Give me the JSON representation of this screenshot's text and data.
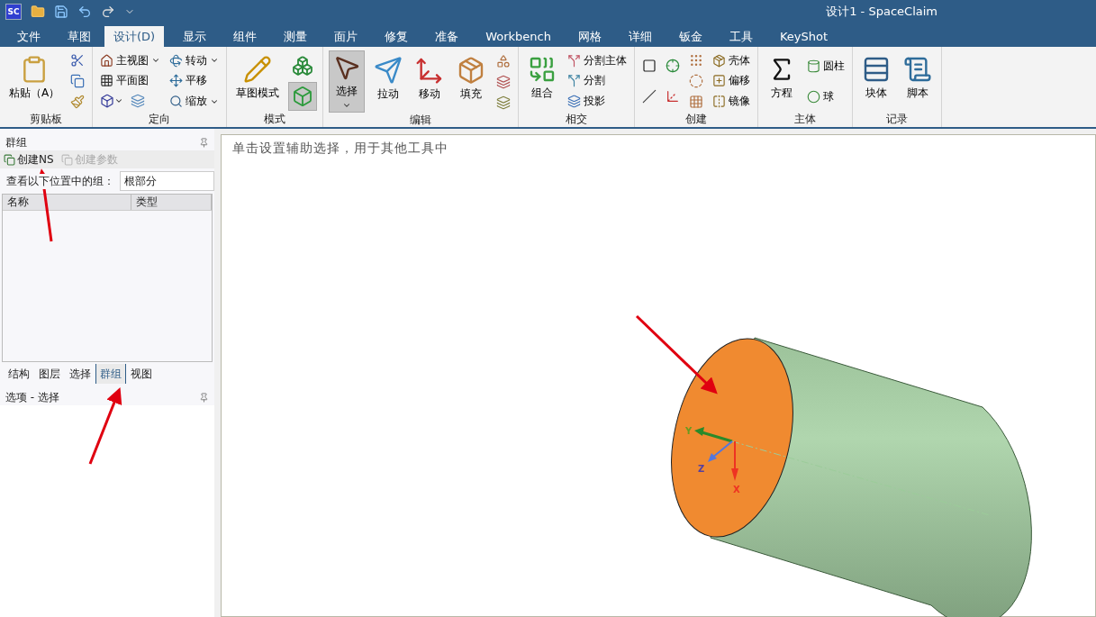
{
  "titlebar": {
    "logo": "SC",
    "title": "设计1 - SpaceClaim"
  },
  "tabs": [
    {
      "label": "文件",
      "selected": false
    },
    {
      "label": "草图",
      "selected": false
    },
    {
      "label": "设计(D)",
      "selected": true
    },
    {
      "label": "显示",
      "selected": false
    },
    {
      "label": "组件",
      "selected": false
    },
    {
      "label": "测量",
      "selected": false
    },
    {
      "label": "面片",
      "selected": false
    },
    {
      "label": "修复",
      "selected": false
    },
    {
      "label": "准备",
      "selected": false
    },
    {
      "label": "Workbench",
      "selected": false
    },
    {
      "label": "网格",
      "selected": false
    },
    {
      "label": "详细",
      "selected": false
    },
    {
      "label": "钣金",
      "selected": false
    },
    {
      "label": "工具",
      "selected": false
    },
    {
      "label": "KeyShot",
      "selected": false
    }
  ],
  "ribbon": [
    {
      "label": "剪贴板",
      "columns": [
        [
          [
            {
              "kind": "large",
              "label": "粘贴（A）",
              "active": false,
              "dropdown": false
            }
          ]
        ],
        [
          [
            {
              "kind": "icon",
              "active": false,
              "dropdown": false
            }
          ],
          [
            {
              "kind": "icon",
              "active": false,
              "dropdown": false
            }
          ],
          [
            {
              "kind": "icon",
              "active": false,
              "dropdown": false
            }
          ]
        ]
      ]
    },
    {
      "label": "定向",
      "columns": [
        [
          [
            {
              "kind": "small",
              "label": "主视图",
              "active": false,
              "dropdown": true
            }
          ],
          [
            {
              "kind": "small",
              "label": "平面图",
              "active": false,
              "dropdown": false
            }
          ],
          [
            {
              "kind": "icon",
              "active": false,
              "dropdown": true
            },
            {
              "kind": "icon",
              "active": false,
              "dropdown": false
            }
          ]
        ],
        [
          [
            {
              "kind": "small",
              "label": "转动",
              "active": false,
              "dropdown": true
            }
          ],
          [
            {
              "kind": "small",
              "label": "平移",
              "active": false,
              "dropdown": false
            }
          ],
          [
            {
              "kind": "small",
              "label": "缩放",
              "active": false,
              "dropdown": true
            }
          ]
        ]
      ]
    },
    {
      "label": "模式",
      "columns": [
        [
          [
            {
              "kind": "large",
              "label": "草图模式",
              "active": false,
              "dropdown": false
            }
          ]
        ],
        [
          [
            {
              "kind": "bigicon",
              "active": false,
              "dropdown": false
            }
          ],
          [
            {
              "kind": "bigicon",
              "active": true,
              "dropdown": false
            }
          ]
        ]
      ]
    },
    {
      "label": "编辑",
      "columns": [
        [
          [
            {
              "kind": "large",
              "label": "选择",
              "active": true,
              "dropdown": true
            }
          ]
        ],
        [
          [
            {
              "kind": "large",
              "label": "拉动",
              "active": false,
              "dropdown": false
            }
          ]
        ],
        [
          [
            {
              "kind": "large",
              "label": "移动",
              "active": false,
              "dropdown": false
            }
          ]
        ],
        [
          [
            {
              "kind": "large",
              "label": "填充",
              "active": false,
              "dropdown": false
            }
          ]
        ],
        [
          [
            {
              "kind": "icon",
              "active": false,
              "dropdown": false
            }
          ],
          [
            {
              "kind": "icon",
              "active": false,
              "dropdown": false
            }
          ],
          [
            {
              "kind": "icon",
              "active": false,
              "dropdown": false
            }
          ]
        ]
      ]
    },
    {
      "label": "相交",
      "columns": [
        [
          [
            {
              "kind": "large",
              "label": "组合",
              "active": false,
              "dropdown": false
            }
          ]
        ],
        [
          [
            {
              "kind": "small",
              "label": "分割主体",
              "active": false,
              "dropdown": false
            }
          ],
          [
            {
              "kind": "small",
              "label": "分割",
              "active": false,
              "dropdown": false
            }
          ],
          [
            {
              "kind": "small",
              "label": "投影",
              "active": false,
              "dropdown": false
            }
          ]
        ]
      ]
    },
    {
      "label": "创建",
      "columns": [
        [
          [
            {
              "kind": "icon",
              "active": false,
              "dropdown": false
            }
          ],
          [
            {
              "kind": "icon",
              "active": false,
              "dropdown": false
            }
          ]
        ],
        [
          [
            {
              "kind": "icon",
              "active": false,
              "dropdown": false
            }
          ],
          [
            {
              "kind": "icon",
              "active": false,
              "dropdown": false
            }
          ]
        ],
        [
          [
            {
              "kind": "icon",
              "active": false,
              "dropdown": false
            }
          ],
          [
            {
              "kind": "icon",
              "active": false,
              "dropdown": false
            }
          ],
          [
            {
              "kind": "icon",
              "active": false,
              "dropdown": false
            }
          ]
        ],
        [
          [
            {
              "kind": "small",
              "label": "壳体",
              "active": false,
              "dropdown": false
            }
          ],
          [
            {
              "kind": "small",
              "label": "偏移",
              "active": false,
              "dropdown": false
            }
          ],
          [
            {
              "kind": "small",
              "label": "镜像",
              "active": false,
              "dropdown": false
            }
          ]
        ]
      ]
    },
    {
      "label": "主体",
      "columns": [
        [
          [
            {
              "kind": "large",
              "label": "方程",
              "active": false,
              "dropdown": false
            }
          ]
        ],
        [
          [
            {
              "kind": "small",
              "label": "圆柱",
              "active": false,
              "dropdown": false
            }
          ],
          [
            {
              "kind": "small",
              "label": "球",
              "active": false,
              "dropdown": false
            }
          ]
        ]
      ]
    },
    {
      "label": "记录",
      "columns": [
        [
          [
            {
              "kind": "large",
              "label": "块体",
              "active": false,
              "dropdown": false
            }
          ]
        ],
        [
          [
            {
              "kind": "large",
              "label": "脚本",
              "active": false,
              "dropdown": false
            }
          ]
        ]
      ]
    }
  ],
  "groups_panel": {
    "title": "群组",
    "toolbar": [
      {
        "label": "创建NS",
        "disabled": false
      },
      {
        "label": "创建参数",
        "disabled": true
      }
    ],
    "filter_label": "查看以下位置中的组：",
    "filter_value": "根部分",
    "columns": [
      "名称",
      "类型"
    ],
    "tabs": [
      {
        "label": "结构",
        "selected": false
      },
      {
        "label": "图层",
        "selected": false
      },
      {
        "label": "选择",
        "selected": false
      },
      {
        "label": "群组",
        "selected": true
      },
      {
        "label": "视图",
        "selected": false
      }
    ]
  },
  "options_panel": {
    "title": "选项 - 选择"
  },
  "canvas": {
    "hint": "单击设置辅助选择，用于其他工具中",
    "axes": [
      "Y",
      "Z",
      "X"
    ]
  }
}
